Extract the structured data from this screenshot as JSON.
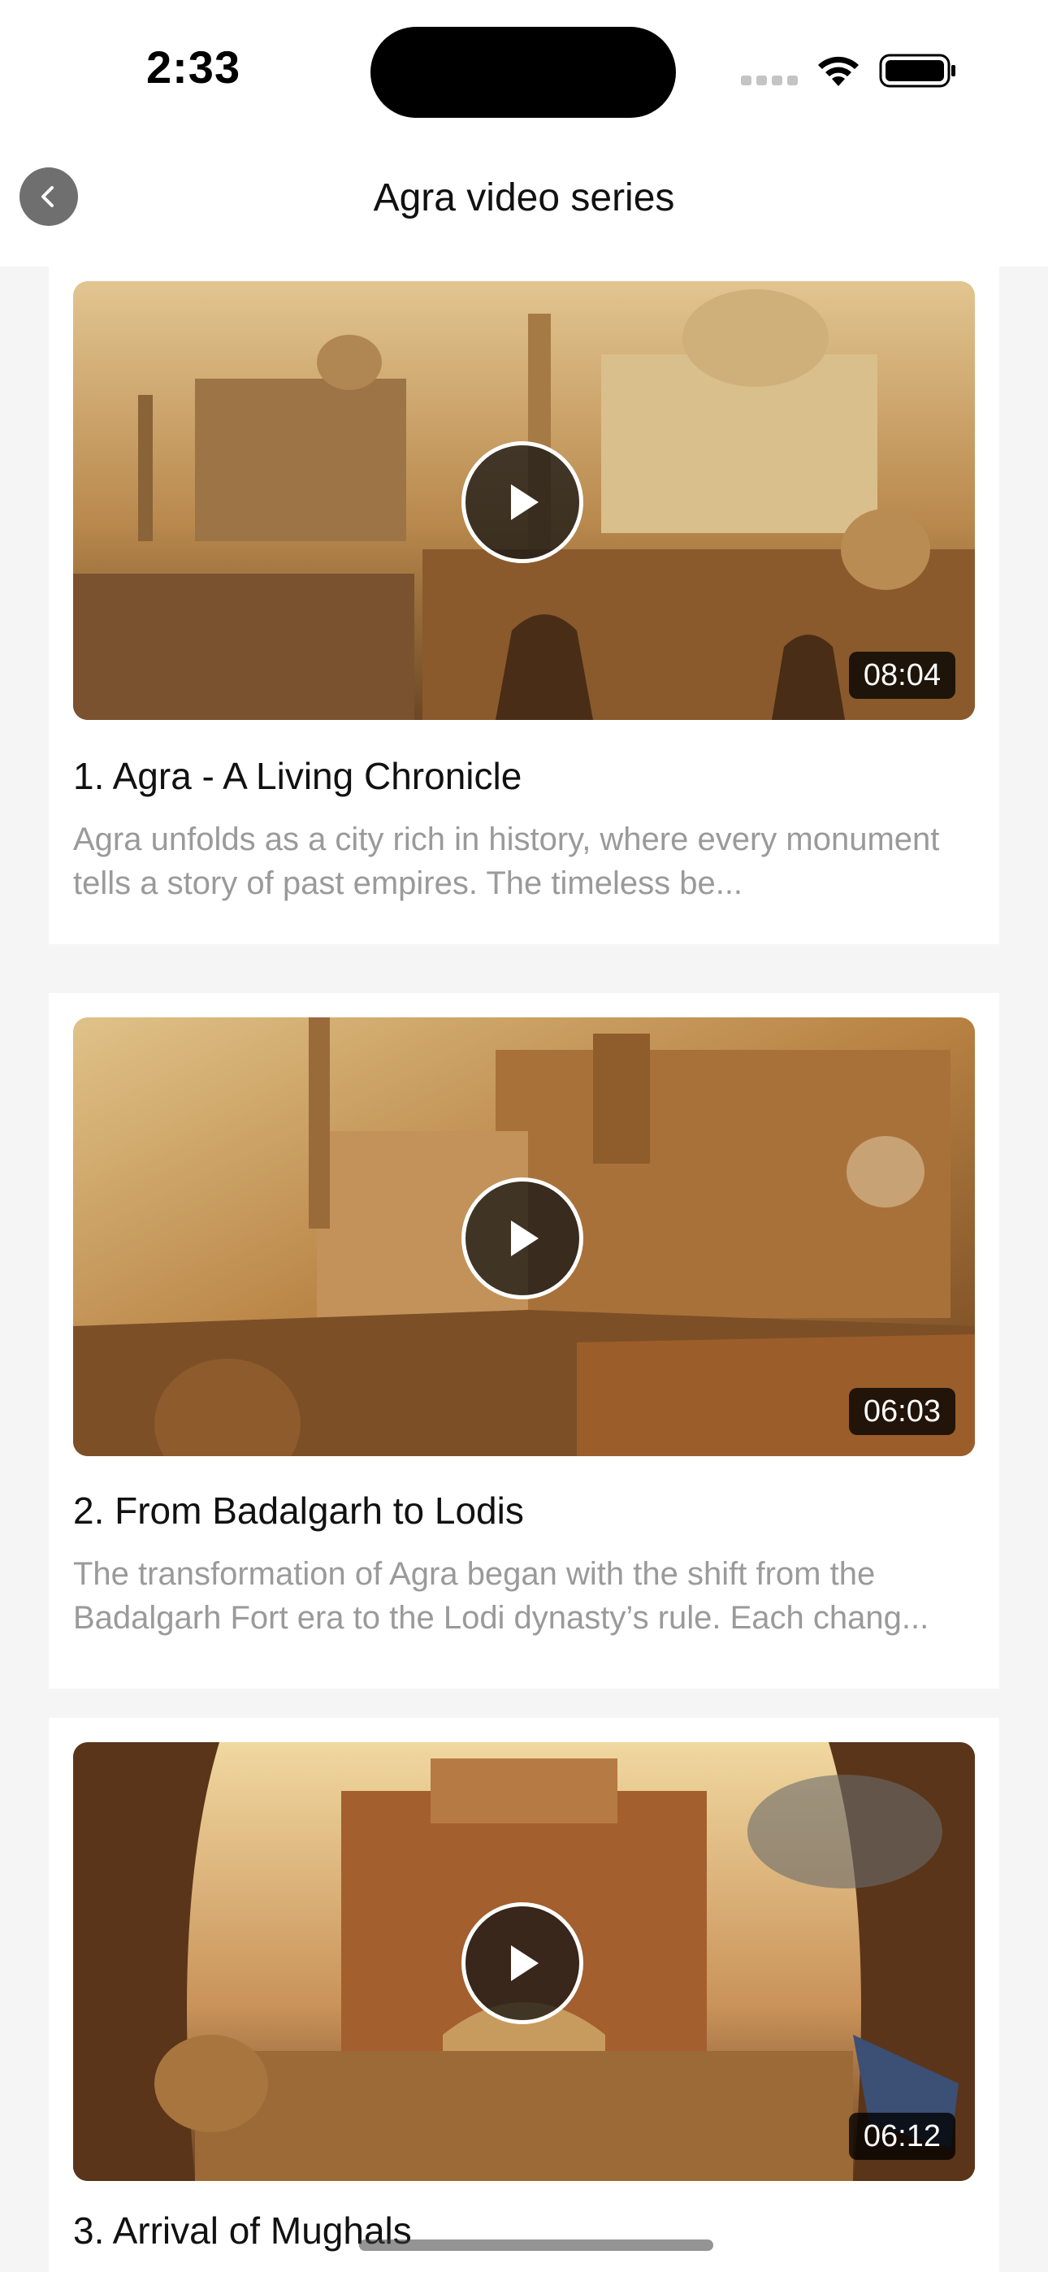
{
  "status_bar": {
    "time": "2:33"
  },
  "nav": {
    "title": "Agra video series",
    "back_icon": "chevron-left-icon"
  },
  "videos": [
    {
      "title": "1. Agra - A Living Chronicle",
      "description": "Agra unfolds as a city rich in history, where every monument tells a story of past empires. The timeless be...",
      "duration": "08:04"
    },
    {
      "title": "2. From Badalgarh to Lodis",
      "description": "The transformation of Agra began with the shift from the Badalgarh Fort era to the Lodi dynasty’s rule. Each chang...",
      "duration": "06:03"
    },
    {
      "title": "3. Arrival of Mughals",
      "description": "",
      "duration": "06:12"
    }
  ],
  "colors": {
    "accent_sand": "#c9a066",
    "overlay_dark": "#141414",
    "text_muted": "#9a9a9a"
  }
}
